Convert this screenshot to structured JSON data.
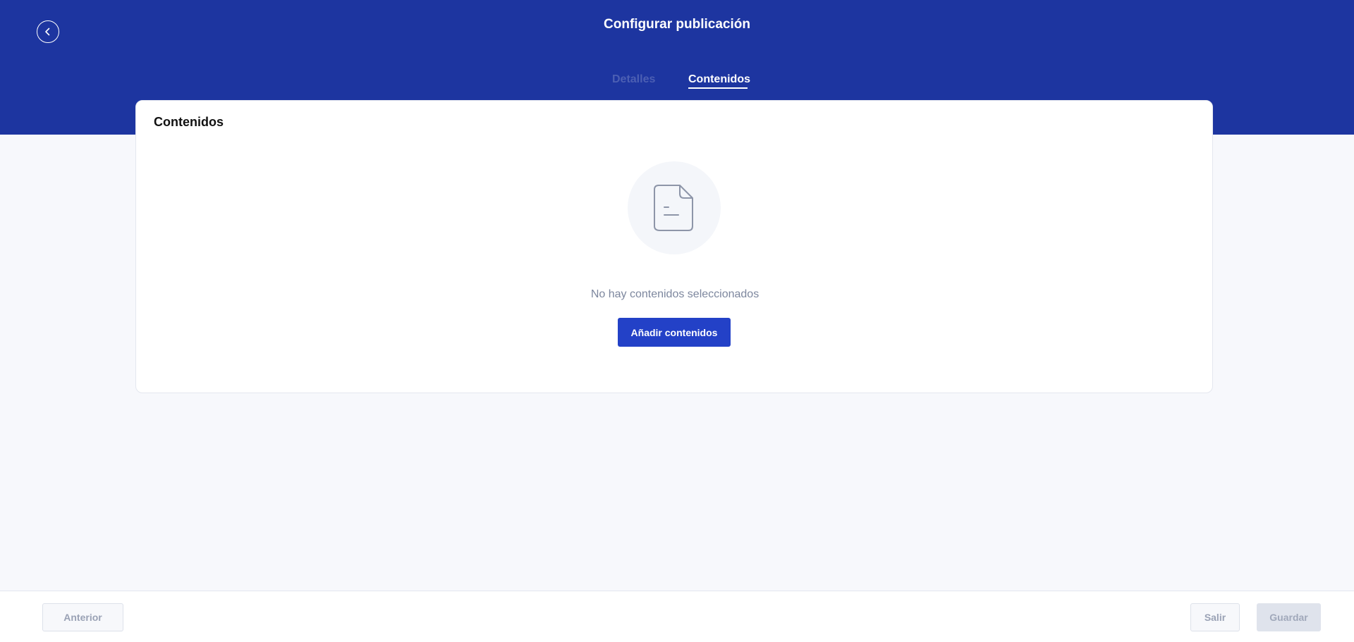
{
  "header": {
    "title": "Configurar publicación",
    "back_icon": "chevron-left-icon",
    "background": "#1d35a0"
  },
  "tabs": [
    {
      "label": "Detalles",
      "active": false
    },
    {
      "label": "Contenidos",
      "active": true
    }
  ],
  "card": {
    "title": "Contenidos",
    "empty_icon": "document-icon",
    "empty_text": "No hay contenidos seleccionados",
    "add_button_label": "Añadir contenidos",
    "accent": "#2341c7"
  },
  "footer": {
    "prev_label": "Anterior",
    "exit_label": "Salir",
    "save_label": "Guardar"
  }
}
